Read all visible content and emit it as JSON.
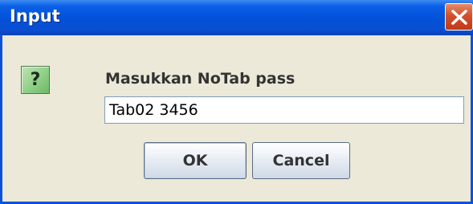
{
  "window": {
    "title": "Input"
  },
  "icons": {
    "close": "close-icon",
    "question": "question-icon",
    "question_glyph": "?"
  },
  "dialog": {
    "prompt": "Masukkan NoTab pass",
    "input_value": "Tab02 3456",
    "ok_label": "OK",
    "cancel_label": "Cancel"
  },
  "colors": {
    "titlebar": "#0250d8",
    "close_button": "#d2502c",
    "dialog_background": "#ece9d8",
    "question_icon": "#8fcf86"
  }
}
